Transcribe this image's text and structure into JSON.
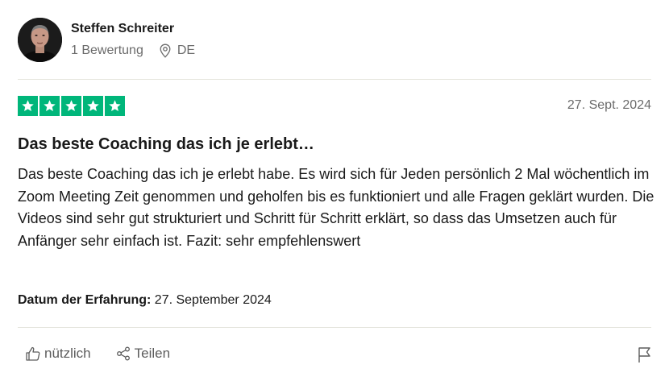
{
  "reviewer": {
    "name": "Steffen Schreiter",
    "review_count": "1 Bewertung",
    "country": "DE"
  },
  "review": {
    "rating": 5,
    "rating_max": 5,
    "star_color": "#00b67a",
    "date": "27. Sept. 2024",
    "title": "Das beste Coaching das ich je erlebt…",
    "body": "Das beste Coaching das ich je erlebt habe. Es wird sich für Jeden persönlich 2 Mal wöchentlich im Zoom Meeting Zeit genommen und geholfen bis es funktioniert und alle Fragen geklärt wurden. Die Videos sind sehr gut strukturiert und Schritt für Schritt erklärt, so dass das Umsetzen auch für Anfänger sehr einfach ist. Fazit: sehr empfehlenswert",
    "experience_label": "Datum der Erfahrung:",
    "experience_date": "27. September 2024"
  },
  "actions": {
    "useful_label": "nützlich",
    "share_label": "Teilen"
  },
  "icons": {
    "location": "location-pin-icon",
    "star": "star-icon",
    "thumbs_up": "thumbs-up-icon",
    "share": "share-icon",
    "flag": "flag-icon"
  }
}
